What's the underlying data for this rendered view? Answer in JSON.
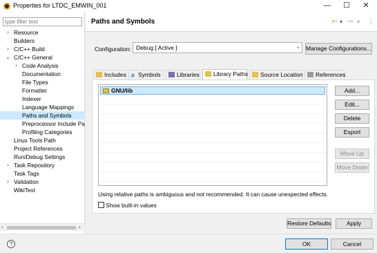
{
  "window": {
    "title": "Properties for LTDC_EMWIN_001",
    "minimize_glyph": "—",
    "maximize_glyph": "☐",
    "close_glyph": "✕"
  },
  "filter": {
    "placeholder": "type filter text"
  },
  "tree": {
    "items": [
      {
        "label": "Resource",
        "toggle": "›",
        "level": 0
      },
      {
        "label": "Builders",
        "toggle": "",
        "level": 0
      },
      {
        "label": "C/C++ Build",
        "toggle": "›",
        "level": 0
      },
      {
        "label": "C/C++ General",
        "toggle": "⌄",
        "level": 0
      },
      {
        "label": "Code Analysis",
        "toggle": "›",
        "level": 1
      },
      {
        "label": "Documentation",
        "toggle": "",
        "level": 1
      },
      {
        "label": "File Types",
        "toggle": "",
        "level": 1
      },
      {
        "label": "Formatter",
        "toggle": "",
        "level": 1
      },
      {
        "label": "Indexer",
        "toggle": "",
        "level": 1
      },
      {
        "label": "Language Mappings",
        "toggle": "",
        "level": 1
      },
      {
        "label": "Paths and Symbols",
        "toggle": "",
        "level": 1,
        "selected": true
      },
      {
        "label": "Preprocessor Include Pa",
        "toggle": "",
        "level": 1
      },
      {
        "label": "Profiling Categories",
        "toggle": "",
        "level": 1
      },
      {
        "label": "Linux Tools Path",
        "toggle": "",
        "level": 0
      },
      {
        "label": "Project References",
        "toggle": "",
        "level": 0
      },
      {
        "label": "Run/Debug Settings",
        "toggle": "",
        "level": 0
      },
      {
        "label": "Task Repository",
        "toggle": "›",
        "level": 0
      },
      {
        "label": "Task Tags",
        "toggle": "",
        "level": 0
      },
      {
        "label": "Validation",
        "toggle": "›",
        "level": 0
      },
      {
        "label": "WikiText",
        "toggle": "",
        "level": 0
      }
    ]
  },
  "header": {
    "title": "Paths and Symbols",
    "back_glyph": "⇦",
    "back_dropdown_glyph": "▾",
    "forward_glyph": "⇨",
    "forward_dropdown_glyph": "▾",
    "menu_glyph": "⋮"
  },
  "configuration": {
    "label": "Configuration:",
    "value": "Debug  [ Active ]",
    "manage_label": "Manage Configurations..."
  },
  "tabs": [
    {
      "label": "Includes",
      "icon": "folder-icon",
      "color": "#e5c04a"
    },
    {
      "label": "Symbols",
      "icon": "hash-icon",
      "color": "#2e5fa8"
    },
    {
      "label": "Libraries",
      "icon": "library-icon",
      "color": "#7a6fb0"
    },
    {
      "label": "Library Paths",
      "icon": "folder-icon",
      "color": "#e5c04a",
      "active": true
    },
    {
      "label": "Source Location",
      "icon": "source-folder-icon",
      "color": "#e5c04a"
    },
    {
      "label": "References",
      "icon": "page-icon",
      "color": "#9c9c9c"
    }
  ],
  "library_paths": {
    "rows": [
      {
        "label": "GNU/lib"
      }
    ]
  },
  "side_buttons": {
    "add": "Add...",
    "edit": "Edit...",
    "delete": "Delete",
    "export": "Export",
    "move_up": "Move Up",
    "move_down": "Move Down"
  },
  "warning": "Using relative paths is ambiguous and not recommended. It can cause unexpected effects.",
  "show_builtin_label": "Show built-in values",
  "restore_defaults_label": "Restore Defaults",
  "apply_label": "Apply",
  "footer": {
    "help_glyph": "?",
    "ok_label": "OK",
    "cancel_label": "Cancel"
  },
  "colors": {
    "selection": "#cce8ff",
    "accent": "#0078d7"
  }
}
